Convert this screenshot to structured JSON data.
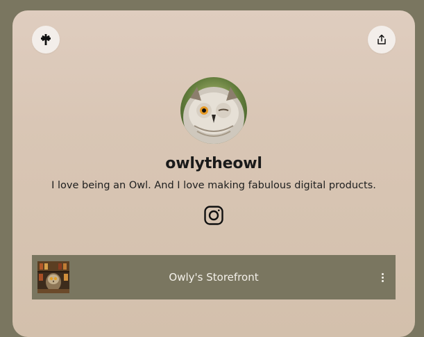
{
  "profile": {
    "username": "owlytheowl",
    "bio": "I love being an Owl. And I love making fabulous digital products."
  },
  "icons": {
    "logo": "linktree-asterisk-icon",
    "share": "share-icon",
    "social": "instagram-icon",
    "menu": "more-vertical-icon"
  },
  "links": [
    {
      "label": "Owly's Storefront"
    }
  ],
  "colors": {
    "page_background": "#7a7660",
    "card_background": "#dccbbb",
    "link_background": "#7a7660",
    "link_text": "#f4f1ea"
  }
}
